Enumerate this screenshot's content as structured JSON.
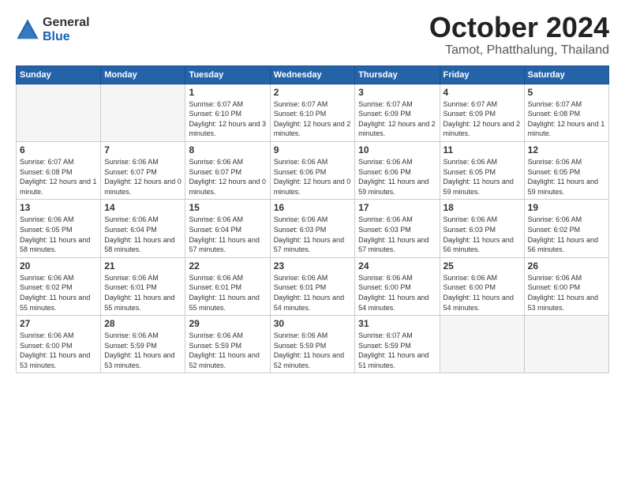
{
  "header": {
    "logo": {
      "general": "General",
      "blue": "Blue"
    },
    "title": "October 2024",
    "location": "Tamot, Phatthalung, Thailand"
  },
  "weekdays": [
    "Sunday",
    "Monday",
    "Tuesday",
    "Wednesday",
    "Thursday",
    "Friday",
    "Saturday"
  ],
  "weeks": [
    [
      {
        "day": "",
        "info": ""
      },
      {
        "day": "",
        "info": ""
      },
      {
        "day": "1",
        "info": "Sunrise: 6:07 AM\nSunset: 6:10 PM\nDaylight: 12 hours and 3 minutes."
      },
      {
        "day": "2",
        "info": "Sunrise: 6:07 AM\nSunset: 6:10 PM\nDaylight: 12 hours and 2 minutes."
      },
      {
        "day": "3",
        "info": "Sunrise: 6:07 AM\nSunset: 6:09 PM\nDaylight: 12 hours and 2 minutes."
      },
      {
        "day": "4",
        "info": "Sunrise: 6:07 AM\nSunset: 6:09 PM\nDaylight: 12 hours and 2 minutes."
      },
      {
        "day": "5",
        "info": "Sunrise: 6:07 AM\nSunset: 6:08 PM\nDaylight: 12 hours and 1 minute."
      }
    ],
    [
      {
        "day": "6",
        "info": "Sunrise: 6:07 AM\nSunset: 6:08 PM\nDaylight: 12 hours and 1 minute."
      },
      {
        "day": "7",
        "info": "Sunrise: 6:06 AM\nSunset: 6:07 PM\nDaylight: 12 hours and 0 minutes."
      },
      {
        "day": "8",
        "info": "Sunrise: 6:06 AM\nSunset: 6:07 PM\nDaylight: 12 hours and 0 minutes."
      },
      {
        "day": "9",
        "info": "Sunrise: 6:06 AM\nSunset: 6:06 PM\nDaylight: 12 hours and 0 minutes."
      },
      {
        "day": "10",
        "info": "Sunrise: 6:06 AM\nSunset: 6:06 PM\nDaylight: 11 hours and 59 minutes."
      },
      {
        "day": "11",
        "info": "Sunrise: 6:06 AM\nSunset: 6:05 PM\nDaylight: 11 hours and 59 minutes."
      },
      {
        "day": "12",
        "info": "Sunrise: 6:06 AM\nSunset: 6:05 PM\nDaylight: 11 hours and 59 minutes."
      }
    ],
    [
      {
        "day": "13",
        "info": "Sunrise: 6:06 AM\nSunset: 6:05 PM\nDaylight: 11 hours and 58 minutes."
      },
      {
        "day": "14",
        "info": "Sunrise: 6:06 AM\nSunset: 6:04 PM\nDaylight: 11 hours and 58 minutes."
      },
      {
        "day": "15",
        "info": "Sunrise: 6:06 AM\nSunset: 6:04 PM\nDaylight: 11 hours and 57 minutes."
      },
      {
        "day": "16",
        "info": "Sunrise: 6:06 AM\nSunset: 6:03 PM\nDaylight: 11 hours and 57 minutes."
      },
      {
        "day": "17",
        "info": "Sunrise: 6:06 AM\nSunset: 6:03 PM\nDaylight: 11 hours and 57 minutes."
      },
      {
        "day": "18",
        "info": "Sunrise: 6:06 AM\nSunset: 6:03 PM\nDaylight: 11 hours and 56 minutes."
      },
      {
        "day": "19",
        "info": "Sunrise: 6:06 AM\nSunset: 6:02 PM\nDaylight: 11 hours and 56 minutes."
      }
    ],
    [
      {
        "day": "20",
        "info": "Sunrise: 6:06 AM\nSunset: 6:02 PM\nDaylight: 11 hours and 55 minutes."
      },
      {
        "day": "21",
        "info": "Sunrise: 6:06 AM\nSunset: 6:01 PM\nDaylight: 11 hours and 55 minutes."
      },
      {
        "day": "22",
        "info": "Sunrise: 6:06 AM\nSunset: 6:01 PM\nDaylight: 11 hours and 55 minutes."
      },
      {
        "day": "23",
        "info": "Sunrise: 6:06 AM\nSunset: 6:01 PM\nDaylight: 11 hours and 54 minutes."
      },
      {
        "day": "24",
        "info": "Sunrise: 6:06 AM\nSunset: 6:00 PM\nDaylight: 11 hours and 54 minutes."
      },
      {
        "day": "25",
        "info": "Sunrise: 6:06 AM\nSunset: 6:00 PM\nDaylight: 11 hours and 54 minutes."
      },
      {
        "day": "26",
        "info": "Sunrise: 6:06 AM\nSunset: 6:00 PM\nDaylight: 11 hours and 53 minutes."
      }
    ],
    [
      {
        "day": "27",
        "info": "Sunrise: 6:06 AM\nSunset: 6:00 PM\nDaylight: 11 hours and 53 minutes."
      },
      {
        "day": "28",
        "info": "Sunrise: 6:06 AM\nSunset: 5:59 PM\nDaylight: 11 hours and 53 minutes."
      },
      {
        "day": "29",
        "info": "Sunrise: 6:06 AM\nSunset: 5:59 PM\nDaylight: 11 hours and 52 minutes."
      },
      {
        "day": "30",
        "info": "Sunrise: 6:06 AM\nSunset: 5:59 PM\nDaylight: 11 hours and 52 minutes."
      },
      {
        "day": "31",
        "info": "Sunrise: 6:07 AM\nSunset: 5:59 PM\nDaylight: 11 hours and 51 minutes."
      },
      {
        "day": "",
        "info": ""
      },
      {
        "day": "",
        "info": ""
      }
    ]
  ]
}
